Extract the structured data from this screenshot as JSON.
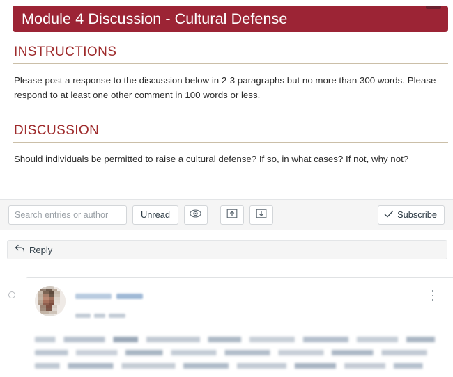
{
  "page": {
    "title": "Module  4  Discussion - Cultural Defense"
  },
  "sections": [
    {
      "heading": "INSTRUCTIONS",
      "body": "Please post a response to the discussion below in 2-3 paragraphs but no more than 300 words. Please respond to at least one other comment in 100 words or less."
    },
    {
      "heading": "DISCUSSION",
      "body": "Should individuals be permitted to raise a cultural defense?  If so, in what cases?  If not, why not?"
    }
  ],
  "toolbar": {
    "search_placeholder": "Search entries or author",
    "search_value": "",
    "unread_label": "Unread",
    "mark_read_icon": "eye-icon",
    "collapse_icon": "collapse-threads-icon",
    "expand_icon": "expand-threads-icon",
    "subscribe_label": "Subscribe",
    "subscribe_icon": "check-icon"
  },
  "reply": {
    "label": "Reply",
    "icon": "reply-arrow-icon"
  },
  "entry": {
    "unread_indicator": "unread-dot",
    "avatar": "user-avatar-blurred",
    "author_name": "",
    "timestamp": "",
    "message": "",
    "menu_icon": "kebab-menu-icon"
  },
  "colors": {
    "banner": "#9c2435",
    "heading": "#9e2a2b",
    "rule": "#cbbfa8",
    "toolbar_bg": "#f5f5f5",
    "border": "#e3e5e7"
  }
}
